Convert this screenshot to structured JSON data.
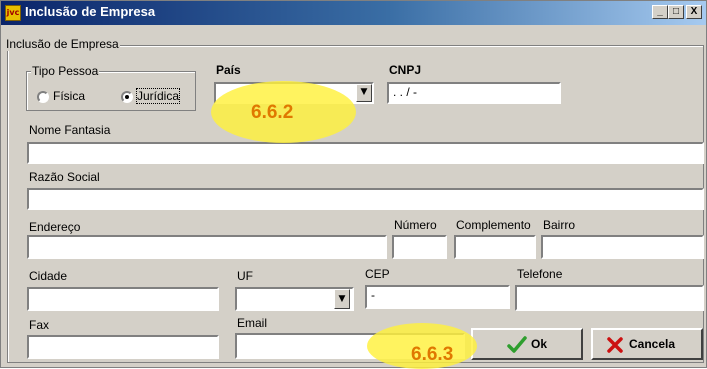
{
  "window": {
    "title": "Inclusão de Empresa",
    "icon_text": "jvc",
    "minimize_glyph": "_",
    "maximize_glyph": "□",
    "close_glyph": "X"
  },
  "form": {
    "group_title": "Inclusão de Empresa",
    "tipo_pessoa": {
      "title": "Tipo Pessoa",
      "options": [
        "Física",
        "Jurídica"
      ],
      "selected": "Jurídica"
    },
    "pais": {
      "label": "País",
      "value": ""
    },
    "cnpj": {
      "label": "CNPJ",
      "value": " .  .  /  -"
    },
    "nome_fantasia": {
      "label": "Nome Fantasia",
      "value": ""
    },
    "razao_social": {
      "label": "Razão Social",
      "value": ""
    },
    "endereco": {
      "label": "Endereço",
      "value": ""
    },
    "numero": {
      "label": "Número",
      "value": ""
    },
    "complemento": {
      "label": "Complemento",
      "value": ""
    },
    "bairro": {
      "label": "Bairro",
      "value": ""
    },
    "cidade": {
      "label": "Cidade",
      "value": ""
    },
    "uf": {
      "label": "UF",
      "value": ""
    },
    "cep": {
      "label": "CEP",
      "value": "  -"
    },
    "telefone": {
      "label": "Telefone",
      "value": ""
    },
    "fax": {
      "label": "Fax",
      "value": ""
    },
    "email": {
      "label": "Email",
      "value": ""
    }
  },
  "buttons": {
    "ok": {
      "label": "Ok",
      "icon": "checkmark-icon",
      "color": "#2e9e2e"
    },
    "cancela": {
      "label": "Cancela",
      "icon": "x-icon",
      "color": "#cc1111"
    }
  },
  "annotations": [
    {
      "text": "6.6.2",
      "color": "#e07800"
    },
    {
      "text": "6.6.3",
      "color": "#e07800"
    }
  ]
}
